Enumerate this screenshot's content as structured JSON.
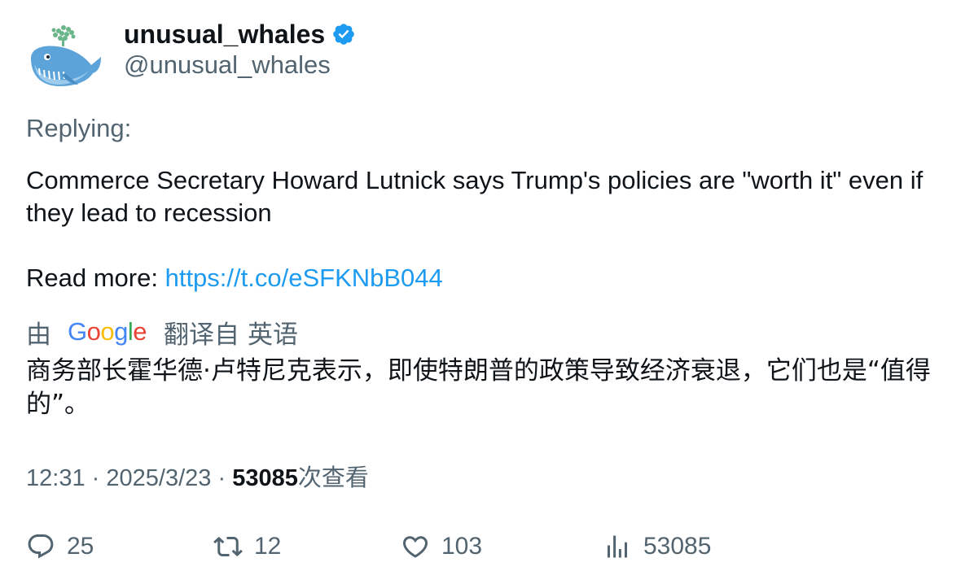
{
  "author": {
    "display_name": "unusual_whales",
    "handle": "@unusual_whales",
    "verified": true,
    "verified_badge_color": "#1d9bf0",
    "avatar_icon": "whale-icon"
  },
  "replying_label": "Replying:",
  "tweet": {
    "text_line": "Commerce Secretary Howard Lutnick says Trump's policies are \"worth it\" even if they lead to recession",
    "read_more_label": "Read more:",
    "link": "https://t.co/eSFKNbB044"
  },
  "translation": {
    "by_label": "由",
    "provider": "Google",
    "translated_from_label": "翻译自",
    "source_language": "英语",
    "text": "商务部长霍华德·卢特尼克表示，即使特朗普的政策导致经济衰退，它们也是“值得的”。"
  },
  "meta": {
    "time": "12:31",
    "date": "2025/3/23",
    "separator": "·",
    "views_count": "53085",
    "views_label": "次查看"
  },
  "actions": {
    "replies": "25",
    "retweets": "12",
    "likes": "103",
    "views": "53085"
  },
  "colors": {
    "text": "#0f1419",
    "muted": "#536471",
    "link": "#1d9bf0"
  }
}
